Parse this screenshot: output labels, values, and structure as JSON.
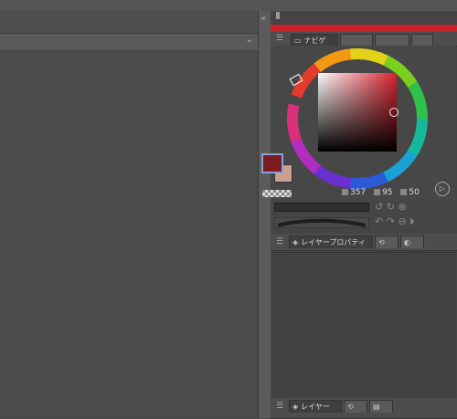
{
  "document": {
    "tab_chevron": "⌄"
  },
  "sidepanel": {
    "collapse_icon": "«"
  },
  "color_panel": {
    "tabs": [
      {
        "label": "ナビゲ"
      },
      {
        "label": ""
      },
      {
        "label": ""
      },
      {
        "label": ""
      }
    ],
    "hsv": {
      "h": "357",
      "s": "95",
      "v": "50"
    },
    "main_color": "#7a1c1f",
    "sub_color": "#c9a08c",
    "accent": "#c8232a"
  },
  "layer_property_panel": {
    "tabs": [
      {
        "label": "レイヤープロパティ"
      },
      {
        "label": ""
      },
      {
        "label": ""
      }
    ]
  },
  "layer_panel": {
    "tabs": [
      {
        "label": "レイヤー"
      },
      {
        "label": ""
      },
      {
        "label": ""
      }
    ]
  }
}
